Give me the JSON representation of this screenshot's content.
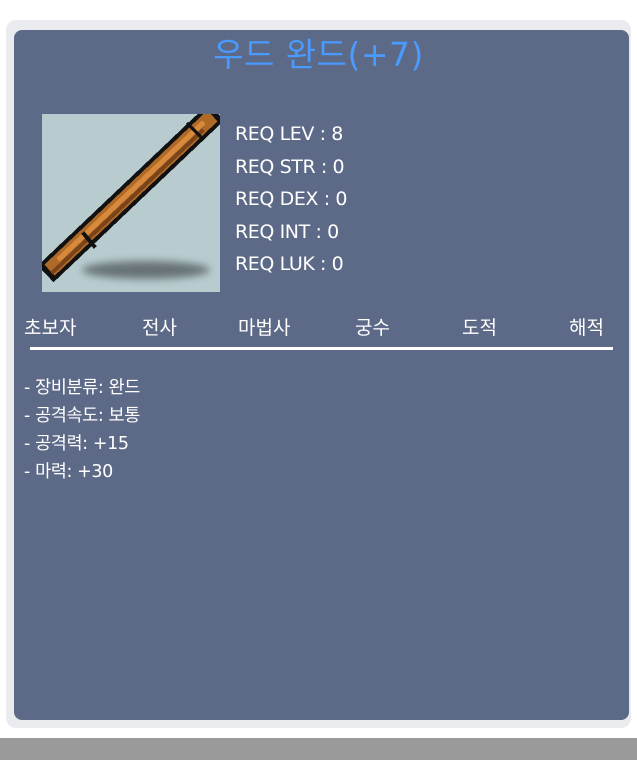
{
  "item": {
    "name": "우드 완드(+7)",
    "icon": "wood-wand-icon"
  },
  "requirements": [
    "REQ LEV : 8",
    "REQ STR : 0",
    "REQ DEX : 0",
    "REQ INT : 0",
    "REQ LUK : 0"
  ],
  "jobs": [
    "초보자",
    "전사",
    "마법사",
    "궁수",
    "도적",
    "해적"
  ],
  "stats": [
    "- 장비분류: 완드",
    "- 공격속도: 보통",
    "- 공격력: +15",
    "- 마력: +30"
  ],
  "colors": {
    "card_background": "#5c6987",
    "title": "#4a9bff",
    "text": "#ffffff",
    "icon_background": "#b8cccf"
  }
}
